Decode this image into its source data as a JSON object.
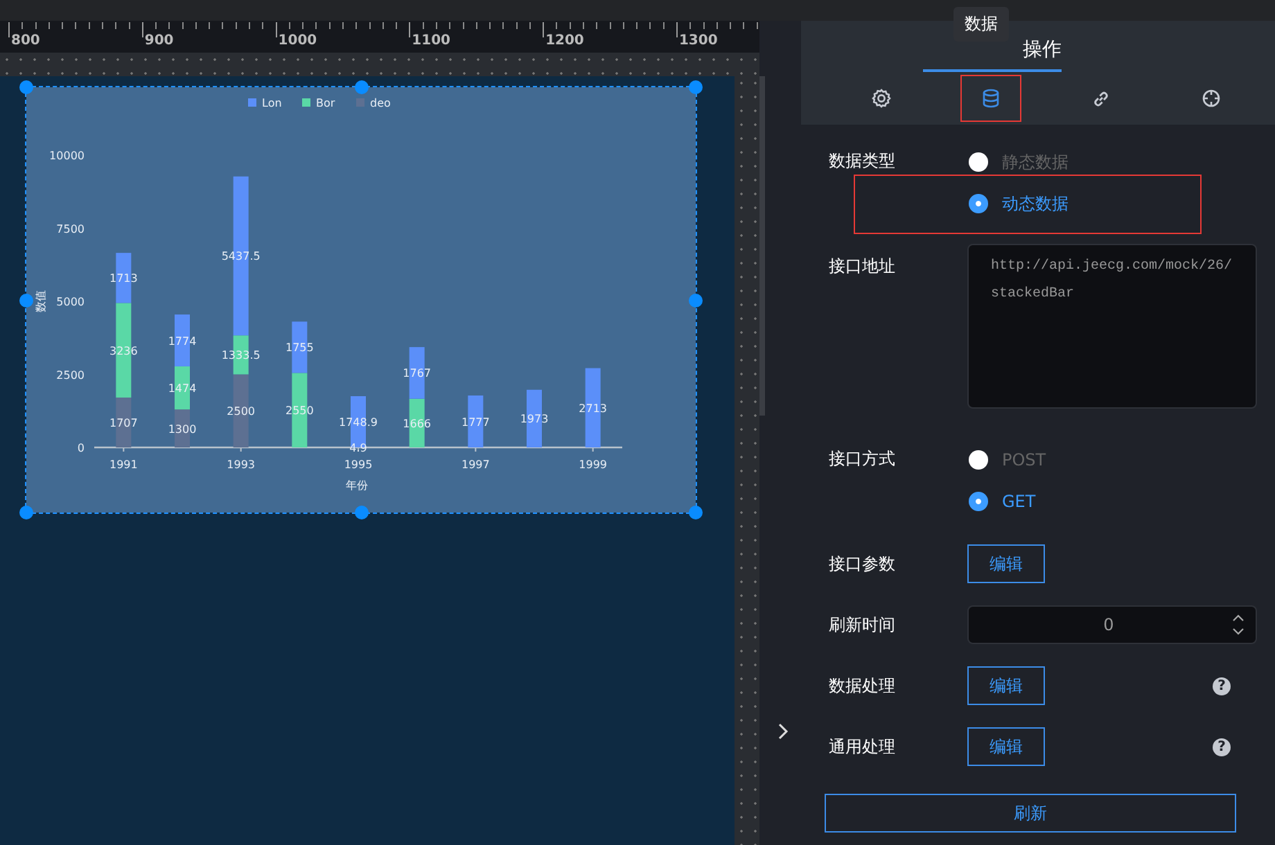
{
  "ruler": {
    "labels": [
      "800",
      "900",
      "1000",
      "1100",
      "1200",
      "1300"
    ]
  },
  "chart_panel": {
    "selected": true,
    "chart_data": {
      "type": "bar",
      "stacked": true,
      "legend": "top",
      "xlim": [
        1990.5,
        1999.5
      ],
      "xlabel": "年份",
      "ylabel": "数值",
      "x": [
        1991,
        1992,
        1993,
        1994,
        1995,
        1996,
        1997,
        1998,
        1999
      ],
      "xticks": [
        1991,
        1993,
        1995,
        1997,
        1999
      ],
      "ylim": [
        0,
        10000
      ],
      "yticks": [
        0,
        2500,
        5000,
        7500,
        10000
      ],
      "series": [
        {
          "name": "deo",
          "color": "#5d7092",
          "values": [
            1707,
            1300,
            2500,
            null,
            4.9,
            null,
            null,
            null,
            null
          ]
        },
        {
          "name": "Bor",
          "color": "#5ad8a6",
          "values": [
            3236,
            1474,
            1333.5,
            2550,
            null,
            1666,
            null,
            null,
            null
          ]
        },
        {
          "name": "Lon",
          "color": "#5b8ff9",
          "values": [
            1713,
            1774,
            5437.5,
            1755,
            1748.9,
            1767,
            1777,
            1973,
            2713
          ]
        }
      ],
      "value_labels": [
        [
          "1707",
          "1300",
          "2500",
          null,
          "4.9",
          null,
          null,
          null,
          null
        ],
        [
          "3236",
          "1474",
          "1333.5",
          "2550",
          null,
          "1666",
          null,
          null,
          null
        ],
        [
          "1713",
          "1774",
          "5437.5",
          "1755",
          "1748.9",
          "1767",
          "1777",
          "1973",
          "2713"
        ]
      ]
    }
  },
  "tooltip": "数据",
  "tabs": [
    {
      "label": "操作",
      "selected": true
    }
  ],
  "icon_tabs": [
    {
      "kind": "gear",
      "selected": false,
      "highlighted": false
    },
    {
      "kind": "database",
      "selected": true,
      "highlighted": true
    },
    {
      "kind": "link",
      "selected": false,
      "highlighted": false
    },
    {
      "kind": "crosshair",
      "selected": false,
      "highlighted": false
    }
  ],
  "form": [
    {
      "kind": "radio",
      "label": "数据类型",
      "options": [
        {
          "label": "静态数据",
          "selected": false,
          "highlighted": false
        },
        {
          "label": "动态数据",
          "selected": true,
          "highlighted": true
        }
      ]
    },
    {
      "kind": "textarea",
      "label": "接口地址",
      "value": "http://api.jeecg.com/mock/26/stackedBar"
    },
    {
      "kind": "radio",
      "label": "接口方式",
      "options": [
        {
          "label": "POST",
          "selected": false,
          "highlighted": false
        },
        {
          "label": "GET",
          "selected": true,
          "highlighted": false
        }
      ]
    },
    {
      "kind": "button",
      "label": "接口参数",
      "button": "编辑"
    },
    {
      "kind": "number",
      "label": "刷新时间",
      "value": "0"
    },
    {
      "kind": "button",
      "label": "数据处理",
      "button": "编辑",
      "help": "?"
    },
    {
      "kind": "button",
      "label": "通用处理",
      "button": "编辑",
      "help": "?"
    }
  ],
  "refresh_button": "刷新"
}
